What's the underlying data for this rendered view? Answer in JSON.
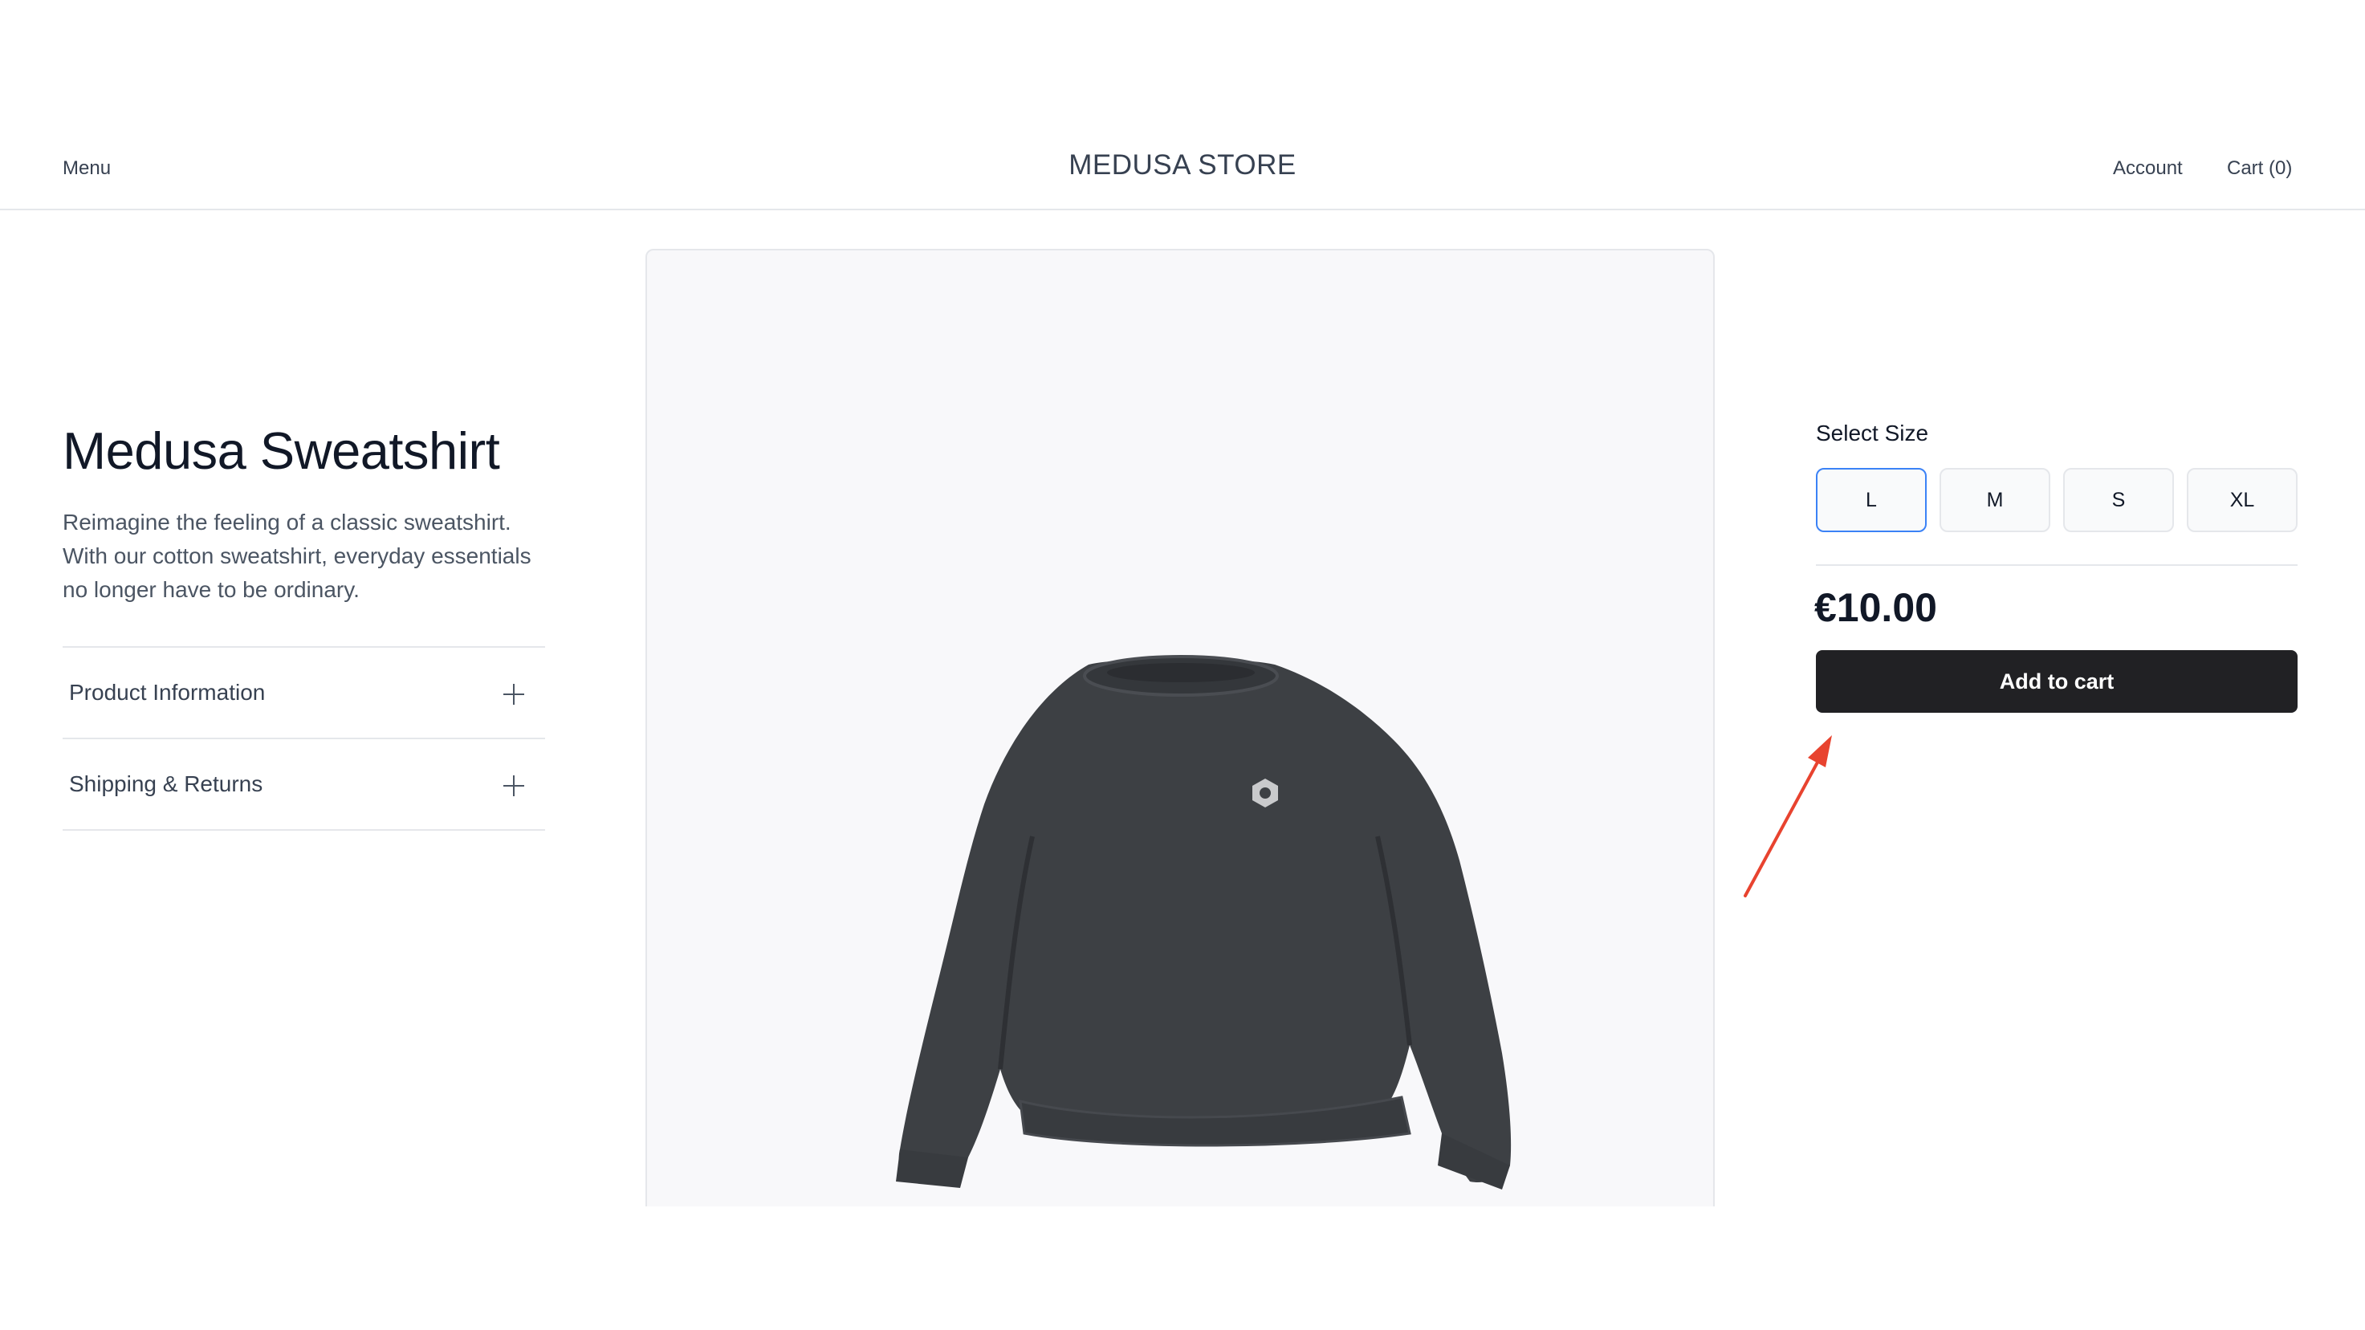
{
  "header": {
    "menu_label": "Menu",
    "store_title": "MEDUSA STORE",
    "account_label": "Account",
    "cart_label": "Cart (0)"
  },
  "product": {
    "title": "Medusa Sweatshirt",
    "description": "Reimagine the feeling of a classic sweatshirt. With our cotton sweatshirt, everyday essentials no longer have to be ordinary.",
    "accordion": [
      {
        "label": "Product Information"
      },
      {
        "label": "Shipping & Returns"
      }
    ],
    "image_icon": "sweatshirt-image"
  },
  "buy_box": {
    "size_label": "Select Size",
    "sizes": [
      "L",
      "M",
      "S",
      "XL"
    ],
    "selected_size": "L",
    "price": "€10.00",
    "add_to_cart_label": "Add to cart"
  },
  "colors": {
    "selected_border": "#3b82f6",
    "primary_button": "#212124",
    "annotation_arrow": "#e8432f"
  }
}
